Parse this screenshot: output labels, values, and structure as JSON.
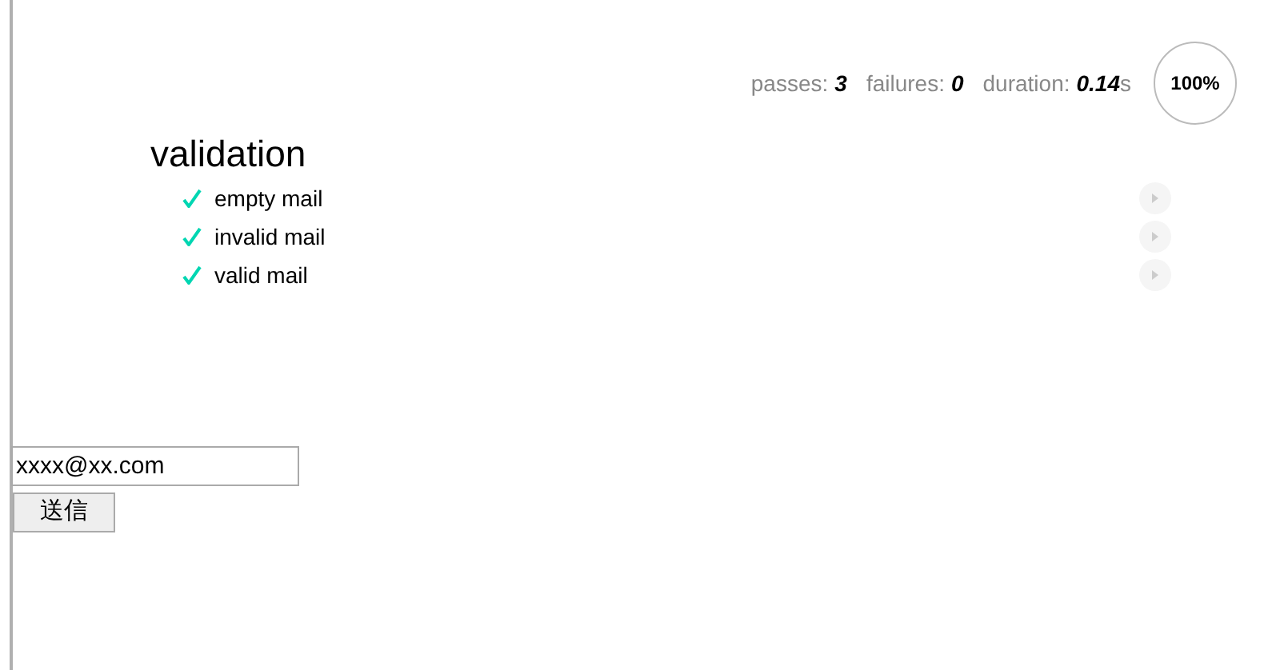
{
  "stats": [
    {
      "label": "passes:",
      "value": "3"
    },
    {
      "label": "failures:",
      "value": "0"
    },
    {
      "label": "duration:",
      "value": "0.14",
      "unit": "s"
    }
  ],
  "progress": {
    "text": "100%"
  },
  "suite": {
    "title": "validation",
    "tests": [
      {
        "title": "empty mail",
        "passed": true
      },
      {
        "title": "invalid mail",
        "passed": true
      },
      {
        "title": "valid mail",
        "passed": true
      }
    ]
  },
  "form": {
    "email_value": "xxxx@xx.com",
    "submit": "送信"
  }
}
